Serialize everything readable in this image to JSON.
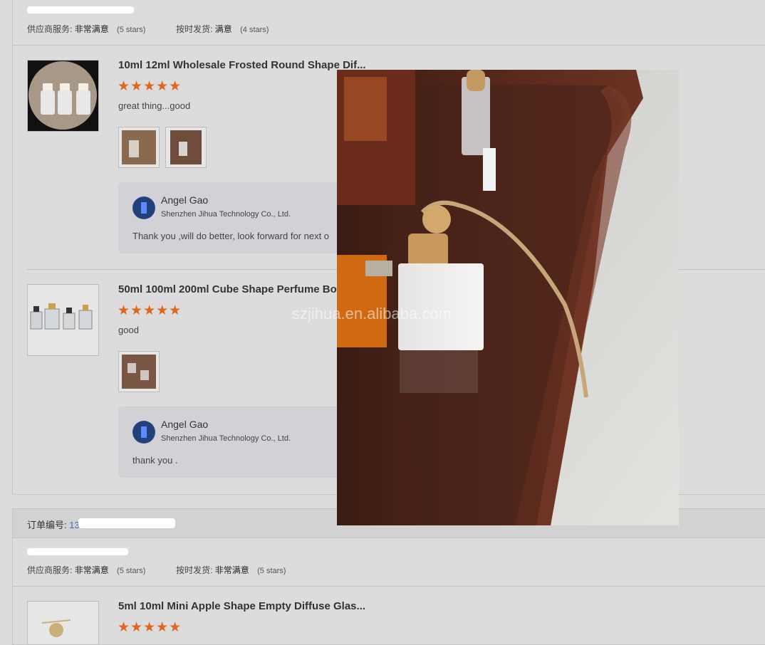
{
  "order1": {
    "supplier_service_label": "供应商服务:",
    "supplier_service_value": "非常满意",
    "supplier_service_stars": "(5 stars)",
    "ontime_label": "按时发货:",
    "ontime_value": "满意",
    "ontime_stars": "(4 stars)",
    "items": [
      {
        "title": "10ml 12ml Wholesale Frosted Round Shape Dif...",
        "stars": "★★★★★",
        "review": "great thing...good",
        "reply": {
          "name": "Angel Gao",
          "company": "Shenzhen Jihua Technology Co., Ltd.",
          "text": "Thank you ,will do better, look forward for next o"
        }
      },
      {
        "title": "50ml 100ml 200ml Cube Shape Perfume Bo",
        "stars": "★★★★★",
        "review": "good",
        "reply": {
          "name": "Angel Gao",
          "company": "Shenzhen Jihua Technology Co., Ltd.",
          "text": "thank you ."
        }
      }
    ]
  },
  "order2": {
    "order_no_label": "订单编号:",
    "order_no_value": "1352",
    "supplier_service_label": "供应商服务:",
    "supplier_service_value": "非常满意",
    "supplier_service_stars": "(5 stars)",
    "ontime_label": "按时发货:",
    "ontime_value": "非常满意",
    "ontime_stars": "(5 stars)",
    "items": [
      {
        "title": "5ml 10ml Mini Apple Shape Empty Diffuse Glas...",
        "stars": "★★★★★"
      }
    ]
  },
  "popup": {
    "watermark": "szjihua.en.alibaba.com"
  },
  "colors": {
    "star": "#e0661d",
    "link": "#3b6bb5",
    "overlay": "#dcdcdc"
  },
  "icons": [
    "star-icon",
    "avatar-image",
    "product-thumbnail"
  ]
}
